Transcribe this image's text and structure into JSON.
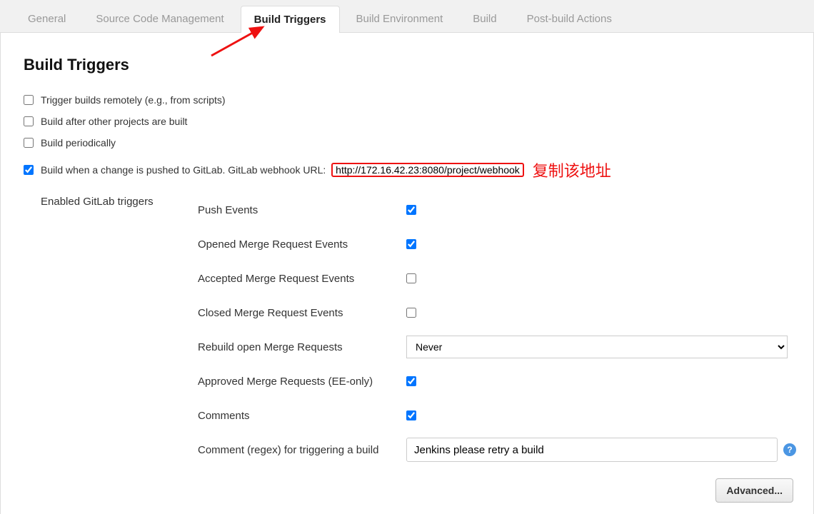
{
  "tabs": [
    {
      "label": "General",
      "active": false
    },
    {
      "label": "Source Code Management",
      "active": false
    },
    {
      "label": "Build Triggers",
      "active": true
    },
    {
      "label": "Build Environment",
      "active": false
    },
    {
      "label": "Build",
      "active": false
    },
    {
      "label": "Post-build Actions",
      "active": false
    }
  ],
  "section_title": "Build Triggers",
  "triggers": {
    "remote": {
      "label": "Trigger builds remotely (e.g., from scripts)",
      "checked": false
    },
    "after_projects": {
      "label": "Build after other projects are built",
      "checked": false
    },
    "periodic": {
      "label": "Build periodically",
      "checked": false
    },
    "gitlab": {
      "label_prefix": "Build when a change is pushed to GitLab. GitLab webhook URL: ",
      "url": "http://172.16.42.23:8080/project/webhook",
      "checked": true
    }
  },
  "annotation_text": "复制该地址",
  "gitlab_sub": {
    "group_label": "Enabled GitLab triggers",
    "push": {
      "label": "Push Events",
      "checked": true
    },
    "opened_mr": {
      "label": "Opened Merge Request Events",
      "checked": true
    },
    "accepted_mr": {
      "label": "Accepted Merge Request Events",
      "checked": false
    },
    "closed_mr": {
      "label": "Closed Merge Request Events",
      "checked": false
    },
    "rebuild_open": {
      "label": "Rebuild open Merge Requests",
      "value": "Never"
    },
    "approved_mr": {
      "label": "Approved Merge Requests (EE-only)",
      "checked": true
    },
    "comments": {
      "label": "Comments",
      "checked": true
    },
    "comment_regex": {
      "label": "Comment (regex) for triggering a build",
      "value": "Jenkins please retry a build"
    }
  },
  "advanced_button": "Advanced...",
  "help_glyph": "?"
}
